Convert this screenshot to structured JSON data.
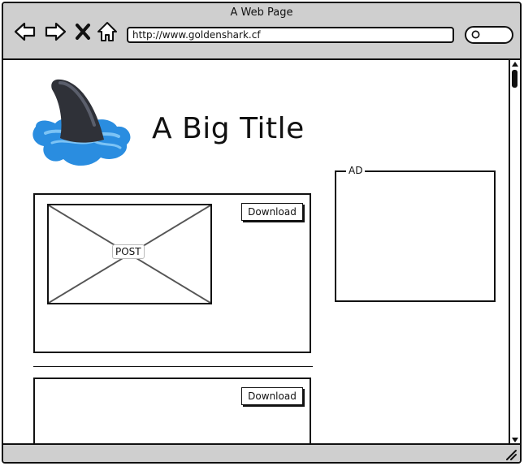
{
  "window": {
    "title": "A Web Page"
  },
  "toolbar": {
    "back_icon": "back-arrow-icon",
    "forward_icon": "forward-arrow-icon",
    "close_icon": "close-x-icon",
    "home_icon": "home-icon",
    "url": "http://www.goldenshark.cf",
    "search_icon": "search-icon"
  },
  "header": {
    "logo": "shark-fin-logo",
    "title": "A Big Title"
  },
  "ad": {
    "label": "AD"
  },
  "posts": [
    {
      "image_label": "POST",
      "download_label": "Download"
    },
    {
      "download_label": "Download"
    }
  ],
  "colors": {
    "chrome": "#cfcfcf",
    "outline": "#111111",
    "logo_water": "#2a8de0",
    "logo_fin": "#2f3138"
  }
}
